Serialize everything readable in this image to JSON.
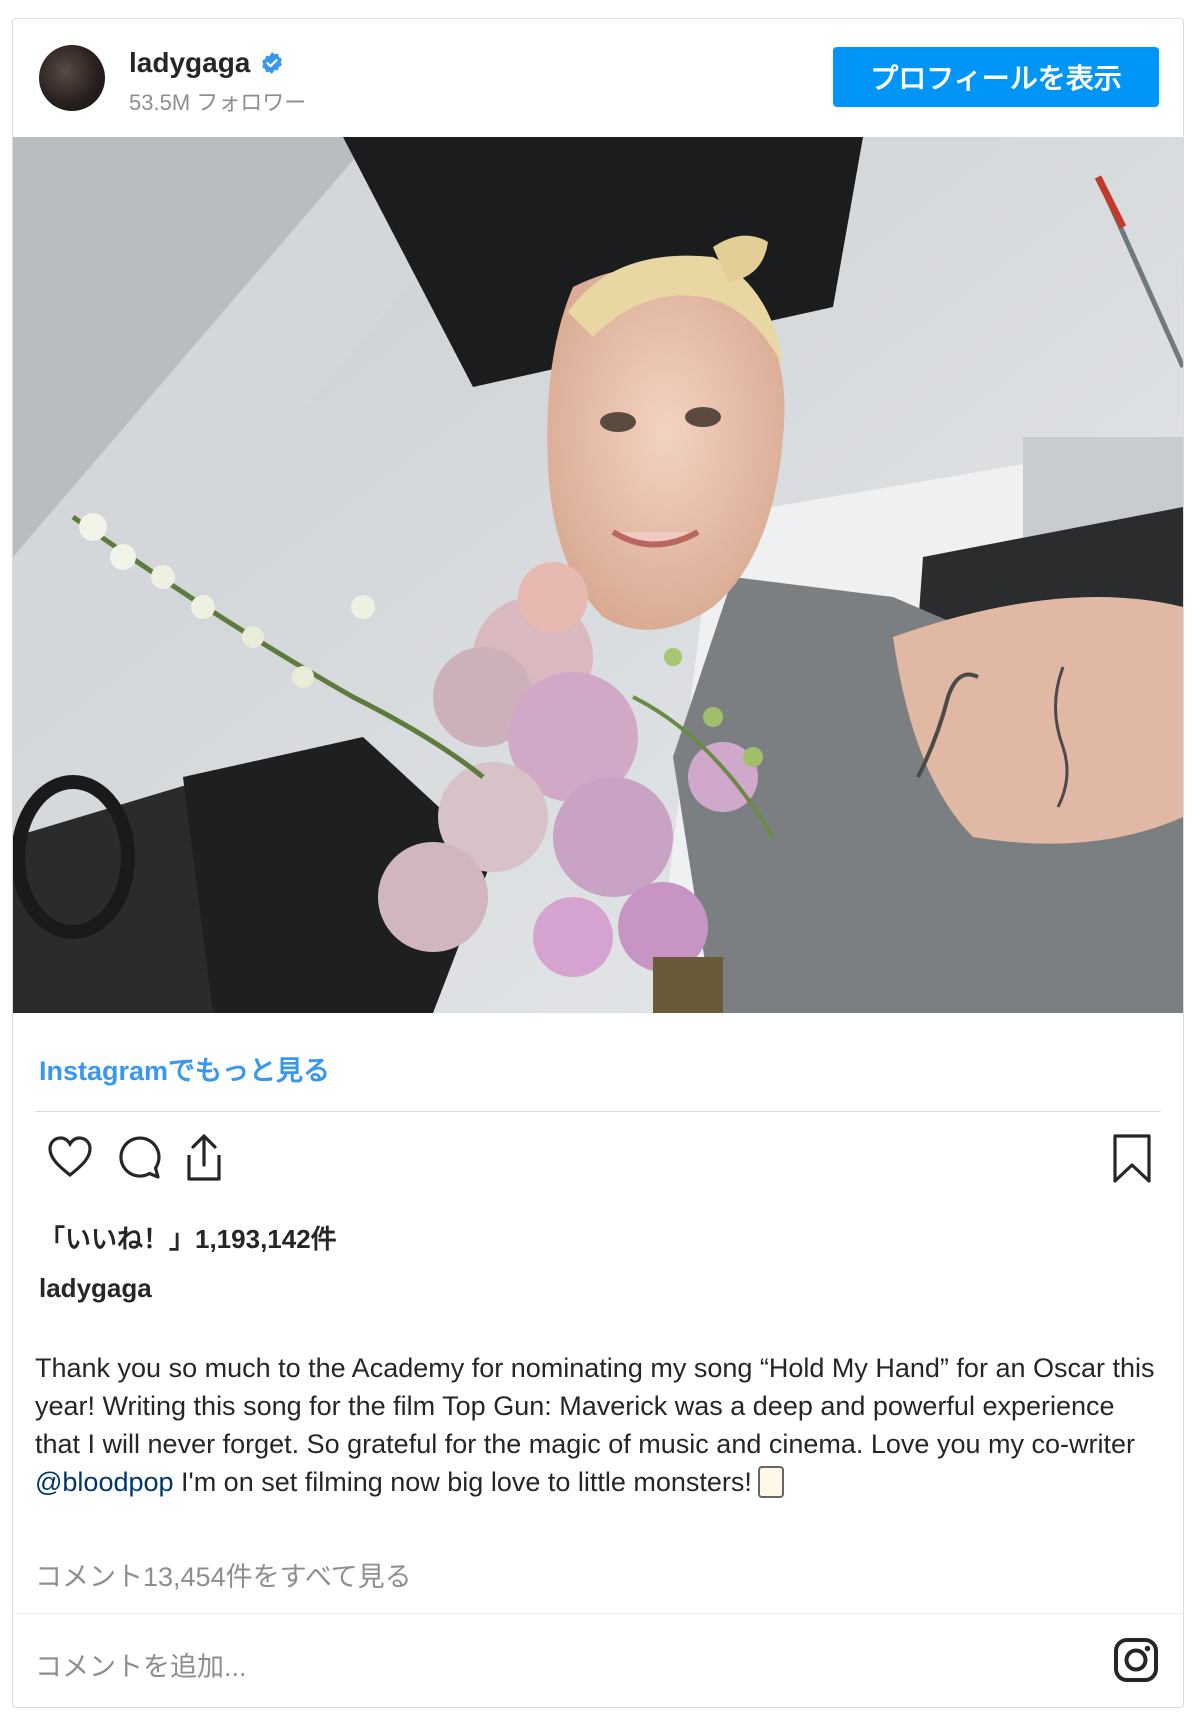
{
  "header": {
    "username": "ladygaga",
    "followers": "53.5M フォロワー",
    "profile_button": "プロフィールを表示"
  },
  "post": {
    "more_link": "Instagramでもっと見る",
    "likes": "「いいね！」1,193,142件",
    "caption_user": "ladygaga",
    "caption_before_mention": "Thank you so much to the Academy for nominating my song “Hold My Hand” for an Oscar this year! Writing this song for the film Top Gun: Maverick was a deep and powerful experience that I will never forget. So grateful for the magic of music and cinema. Love you my co-writer ",
    "mention": "@bloodpop",
    "caption_after_mention": " I'm on set filming now big love to little monsters!",
    "comments_link": "コメント13,454件をすべて見る",
    "add_comment_placeholder": "コメントを追加..."
  },
  "colors": {
    "accent": "#0095f6",
    "link": "#3897f0",
    "mention": "#00376b",
    "muted": "#8e8e8e"
  },
  "icons": [
    "verified-badge-icon",
    "heart-icon",
    "comment-icon",
    "share-icon",
    "bookmark-icon",
    "instagram-logo-icon"
  ]
}
